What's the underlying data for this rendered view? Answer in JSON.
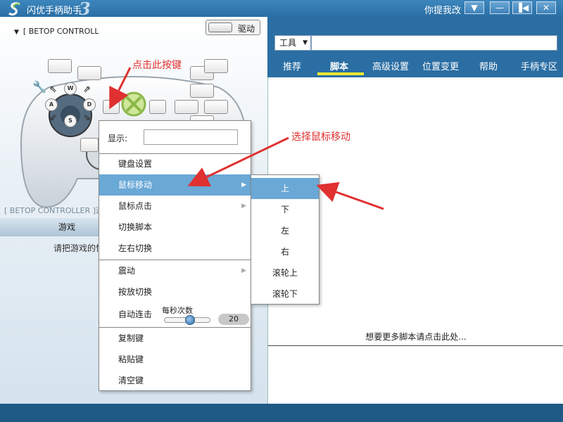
{
  "window": {
    "title": "闪优手柄助手",
    "version_mark": "3",
    "feedback": "你提我改",
    "buttons": {
      "dropdown": "▼",
      "minimize": "—",
      "dock": "▐◀",
      "close": "✕"
    }
  },
  "left": {
    "controller_name": "[ BETOP CONTROLL",
    "driver_label": "驱动",
    "dpad_letters": {
      "up": "W",
      "left": "A",
      "right": "D",
      "down": "S"
    },
    "status_text": "[ BETOP CONTROLLER ]连",
    "tab_game": "游戏",
    "hint": "请把游戏的快"
  },
  "right": {
    "tool_select": "工具",
    "tabs": [
      "推荐",
      "脚本",
      "高级设置",
      "位置变更",
      "帮助",
      "手柄专区"
    ],
    "active_tab": 1,
    "more_scripts": "想要更多脚本请点击此处..."
  },
  "annotations": {
    "click_key": "点击此按键",
    "choose_mouse_move": "选择鼠标移动"
  },
  "context_menu": {
    "display_label": "显示:",
    "items_group1": [
      "键盘设置",
      "鼠标移动",
      "鼠标点击",
      "切换脚本",
      "左右切换"
    ],
    "items_group2": [
      "震动",
      "按放切换",
      "自动连击"
    ],
    "items_group3": [
      "复制键",
      "粘贴键",
      "清空键"
    ],
    "slider_label": "每秒次数",
    "slider_value": "20",
    "submenu_arrow": "▶"
  },
  "submenu": {
    "items": [
      "上",
      "下",
      "左",
      "右",
      "滚轮上",
      "滚轮下"
    ]
  },
  "colors": {
    "title_bar": "#2f78ae",
    "highlight": "#6aa8d6",
    "annotation_red": "#e03030",
    "tab_underline": "#f0e830"
  }
}
